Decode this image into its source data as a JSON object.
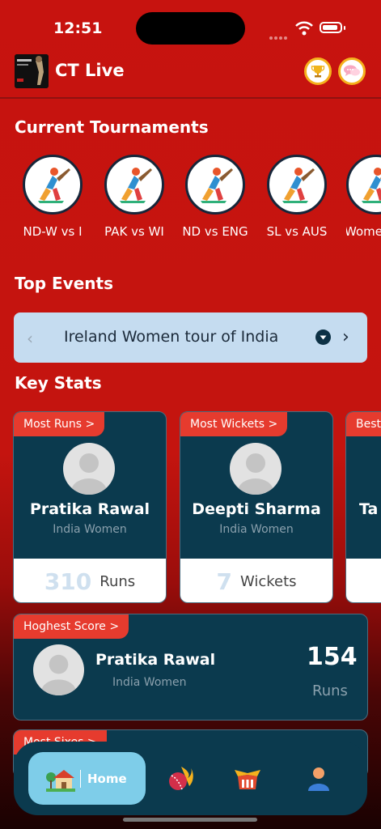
{
  "status_bar": {
    "time": "12:51"
  },
  "header": {
    "app_title": "CT Live",
    "icons": [
      "trophy-icon",
      "chat-icon"
    ]
  },
  "tournaments": {
    "title": "Current Tournaments",
    "items": [
      {
        "label": "ND-W vs I"
      },
      {
        "label": "PAK vs WI"
      },
      {
        "label": "ND vs ENG"
      },
      {
        "label": "SL vs AUS"
      },
      {
        "label": "Wome"
      }
    ]
  },
  "top_events": {
    "title": "Top Events",
    "selected": "Ireland Women tour of India"
  },
  "key_stats": {
    "title": "Key Stats",
    "cards": [
      {
        "tag": "Most Runs >",
        "name": "Pratika Rawal",
        "team": "India Women",
        "value": "310",
        "unit": "Runs"
      },
      {
        "tag": "Most Wickets >",
        "name": "Deepti Sharma",
        "team": "India Women",
        "value": "7",
        "unit": "Wickets"
      },
      {
        "tag": "Best",
        "name": "Ta",
        "team": "",
        "value": "",
        "unit": ""
      }
    ],
    "highest_score": {
      "tag": "Hoghest Score >",
      "name": "Pratika Rawal",
      "team": "India Women",
      "score": "154",
      "unit": "Runs"
    },
    "most_sixes": {
      "tag": "Most Sixes >"
    }
  },
  "bottom_nav": {
    "home_label": "Home",
    "items": [
      "home-icon",
      "cricket-ball-icon",
      "team-badge-icon",
      "profile-icon"
    ]
  },
  "colors": {
    "background": "#c7130f",
    "card": "#0b3a4e",
    "tag": "#e63b2e",
    "home_active": "#7ecde9"
  }
}
